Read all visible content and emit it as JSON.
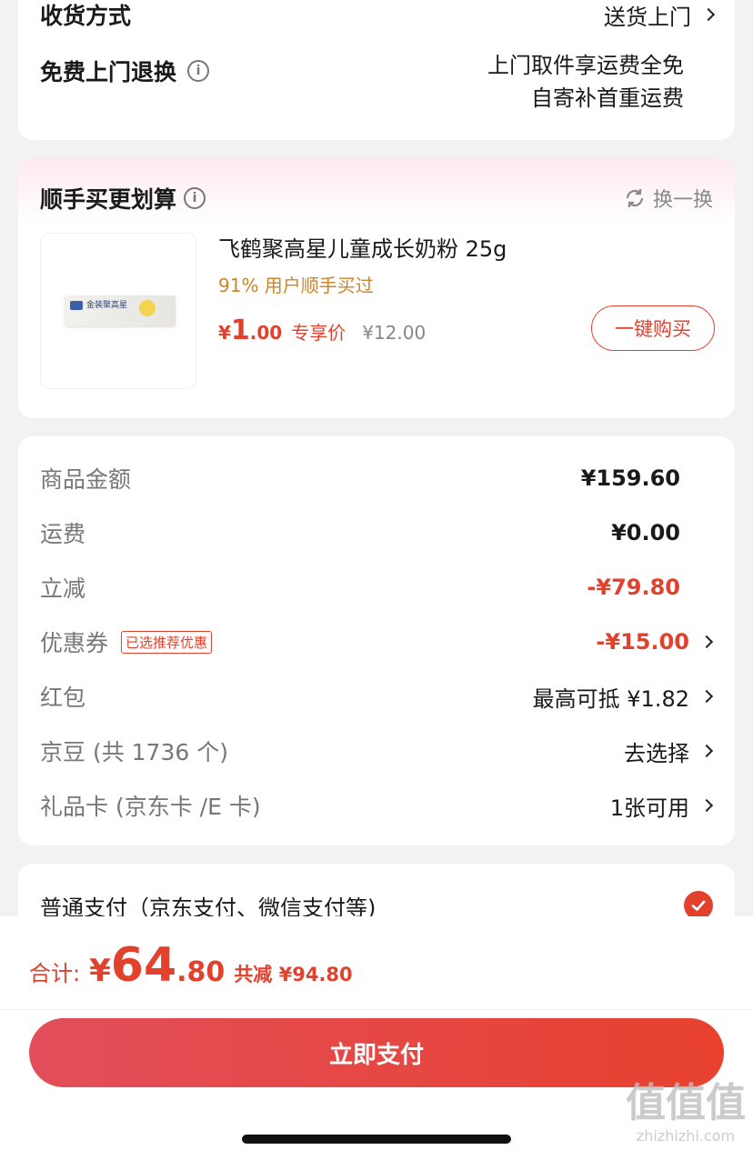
{
  "delivery": {
    "method_label": "收货方式",
    "method_value": "送货上门",
    "return_label": "免费上门退换",
    "return_info_icon": "info-icon",
    "return_line1": "上门取件享运费全免",
    "return_line2": "自寄补首重运费"
  },
  "upsell": {
    "title": "顺手买更划算",
    "swap_label": "换一换",
    "swap_icon": "refresh-icon",
    "product_name": "飞鹤聚高星儿童成长奶粉 25g",
    "bought_text": "91% 用户顺手买过",
    "price_symbol": "¥",
    "price_int": "1",
    "price_dec": ".00",
    "price_note": "专享价",
    "orig_price": "¥12.00",
    "buy_button": "一键购买",
    "image_text": "金装聚高星"
  },
  "fees": {
    "items": [
      {
        "label": "商品金额",
        "value": "¥159.60"
      },
      {
        "label": "运费",
        "value": "¥0.00"
      },
      {
        "label": "立减",
        "value": "-¥79.80"
      },
      {
        "label": "优惠券",
        "tag": "已选推荐优惠",
        "value": "-¥15.00"
      },
      {
        "label": "红包",
        "value": "最高可抵 ¥1.82"
      },
      {
        "label": "京豆 (共 1736 个)",
        "value": "去选择"
      },
      {
        "label": "礼品卡 (京东卡 /E 卡)",
        "value": "1张可用"
      }
    ]
  },
  "payment": {
    "method_label": "普通支付（京东支付、微信支付等)"
  },
  "footer": {
    "total_label": "合计:",
    "total_symbol": "¥",
    "total_int": "64",
    "total_dec": ".80",
    "saved_label": "共减 ¥94.80",
    "pay_button": "立即支付"
  },
  "watermark": {
    "logo": "值值值",
    "site": "zhizhizhi.com"
  },
  "colors": {
    "accent": "#e2412e",
    "gold": "#c8862b"
  }
}
